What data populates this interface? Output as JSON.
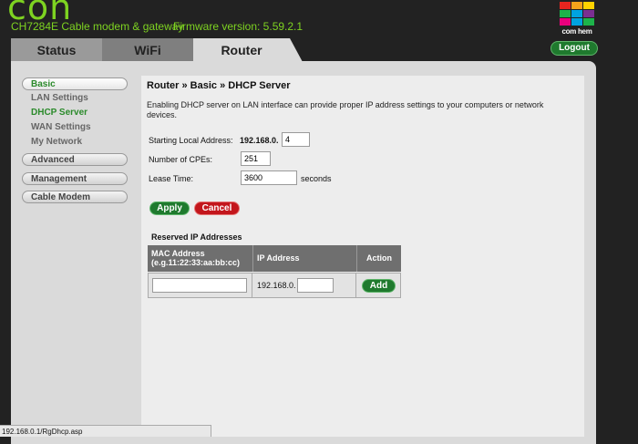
{
  "header": {
    "logo_partial": "con",
    "model": "CH7284E Cable modem & gateway",
    "firmware": "Firmware version: 5.59.2.1",
    "brand": {
      "label": "com hem",
      "colors": [
        "#e8251f",
        "#f6a21b",
        "#ffd200",
        "#1db34a",
        "#00a3e0",
        "#7b2f91",
        "#e8007d",
        "#00a3e0",
        "#1db34a"
      ]
    },
    "logout_label": "Logout"
  },
  "tabs": [
    {
      "label": "Status"
    },
    {
      "label": "WiFi"
    },
    {
      "label": "Router"
    }
  ],
  "sidebar": {
    "basic": "Basic",
    "basic_items": [
      "LAN Settings",
      "DHCP Server",
      "WAN Settings",
      "My Network"
    ],
    "advanced": "Advanced",
    "management": "Management",
    "cable_modem": "Cable Modem"
  },
  "main": {
    "breadcrumb": "Router » Basic » DHCP Server",
    "description": "Enabling DHCP server on LAN interface can provide proper IP address settings to your computers or network devices.",
    "starting_address_label": "Starting Local Address:",
    "starting_address_prefix": "192.168.0.",
    "starting_address_value": "4",
    "cpes_label": "Number of CPEs:",
    "cpes_value": "251",
    "lease_label": "Lease Time:",
    "lease_value": "3600",
    "lease_unit": "seconds",
    "apply_label": "Apply",
    "cancel_label": "Cancel",
    "reserved_title": "Reserved IP Addresses",
    "table": {
      "col_mac_line1": "MAC Address",
      "col_mac_line2": "(e.g.11:22:33:aa:bb:cc)",
      "col_ip": "IP Address",
      "col_action": "Action",
      "mac_value": "",
      "ip_prefix": "192.168.0.",
      "ip_value": "",
      "add_label": "Add"
    }
  },
  "status_bar": {
    "url": "192.168.0.1/RgDhcp.asp"
  }
}
